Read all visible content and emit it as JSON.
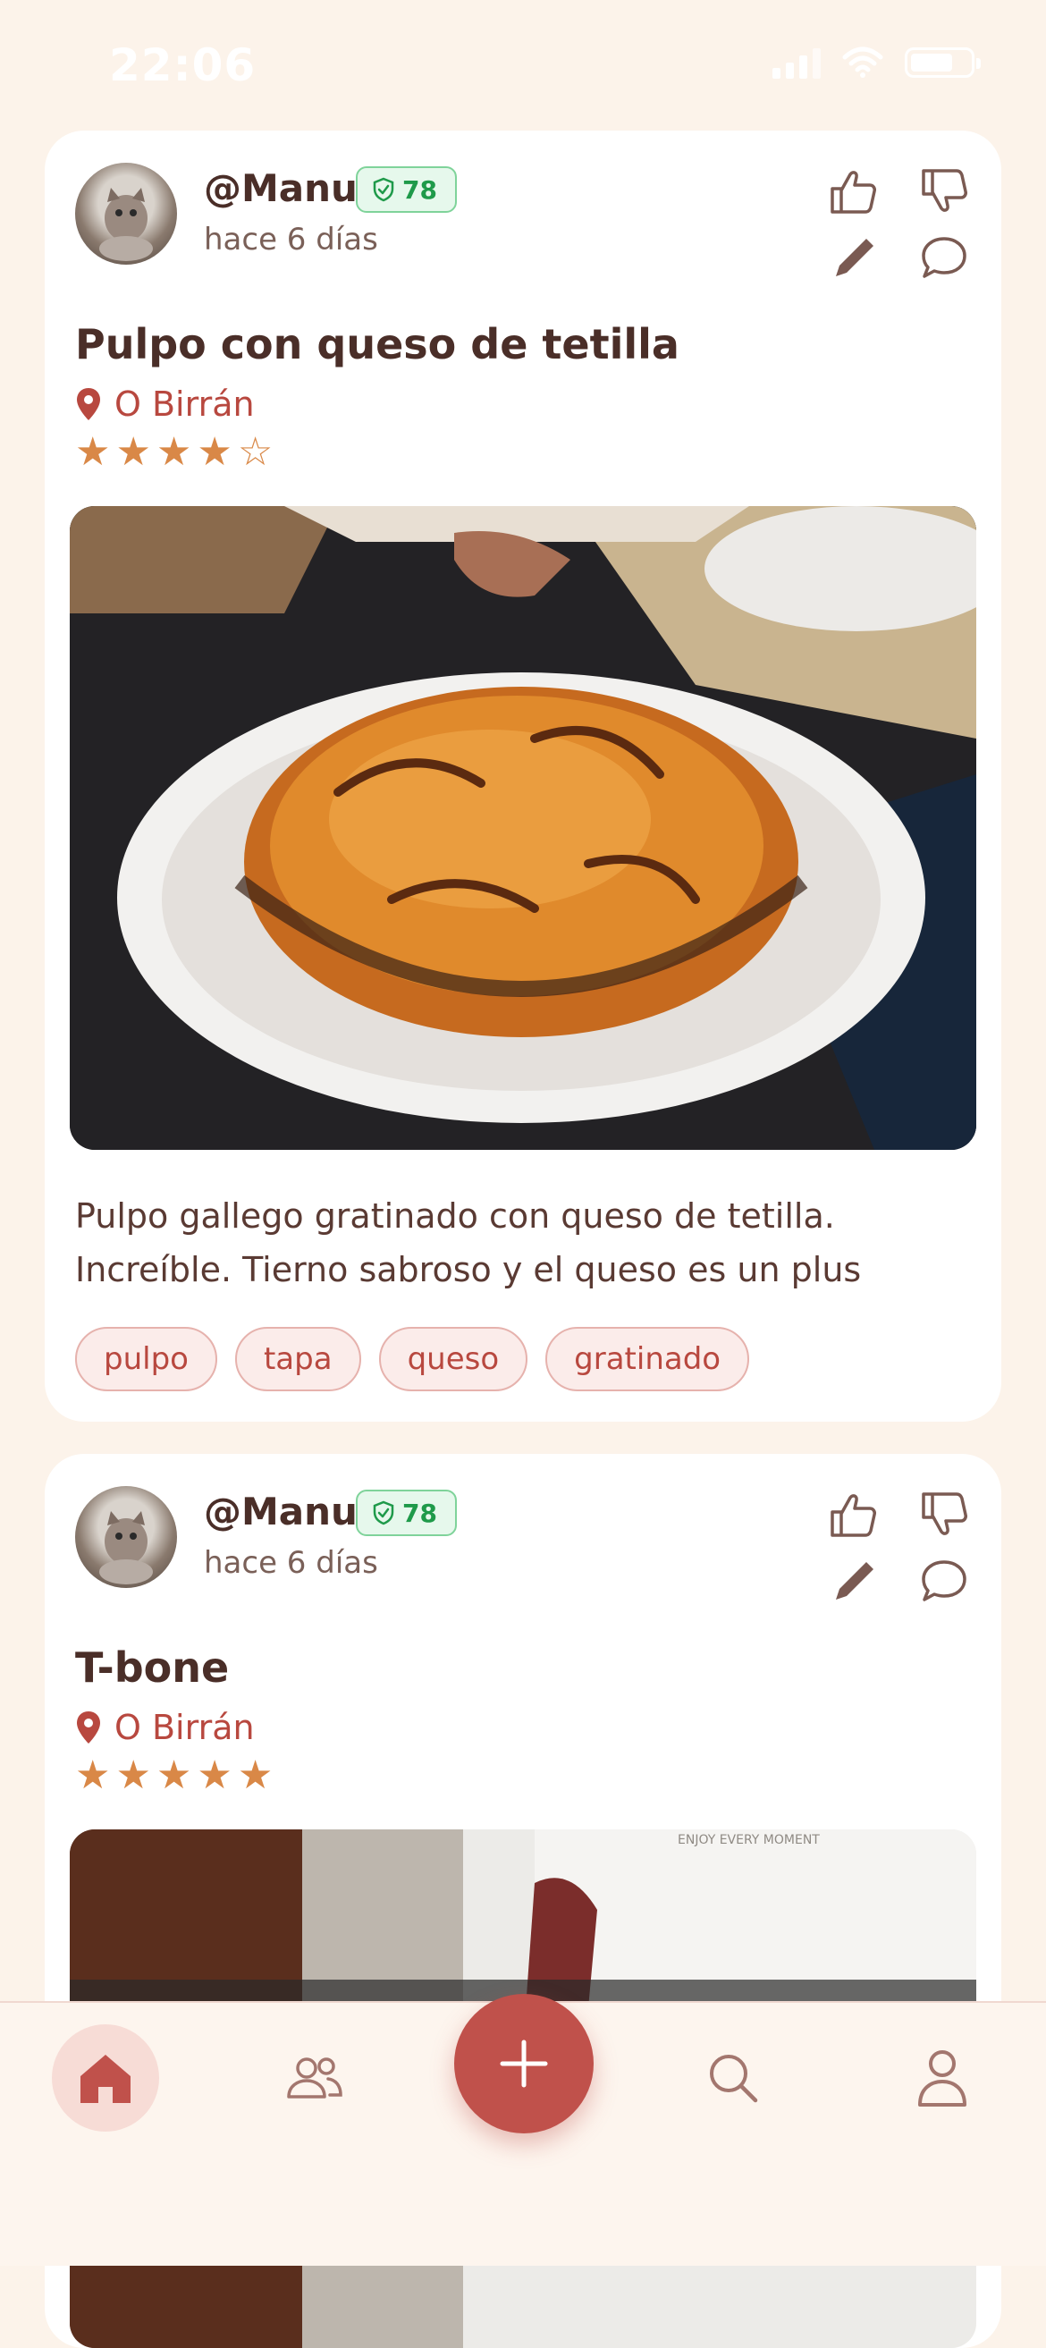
{
  "status_bar": {
    "time": "22:06"
  },
  "posts": [
    {
      "username": "@Manu",
      "score": "78",
      "time_ago": "hace 6 días",
      "title": "Pulpo con queso de tetilla",
      "location": "O Birrán",
      "rating": 4,
      "rating_max": 5,
      "description_line1": "Pulpo gallego gratinado con queso de tetilla.",
      "description_line2": "Increíble. Tierno sabroso y el queso es un plus",
      "tags": [
        "pulpo",
        "tapa",
        "queso",
        "gratinado"
      ]
    },
    {
      "username": "@Manu",
      "score": "78",
      "time_ago": "hace 6 días",
      "title": "T-bone",
      "location": "O Birrán",
      "rating": 5,
      "rating_max": 5
    }
  ],
  "photo2_print": "ENJOY EVERY MOMENT",
  "colors": {
    "accent": "#c0514b",
    "star": "#d98847",
    "badge_green": "#1f9a4a",
    "background": "#fcf3ea"
  },
  "icons": [
    "thumbs-up-icon",
    "thumbs-down-icon",
    "pencil-icon",
    "comment-icon",
    "map-pin-icon",
    "shield-check-icon",
    "home-icon",
    "users-icon",
    "plus-icon",
    "search-icon",
    "user-icon"
  ]
}
